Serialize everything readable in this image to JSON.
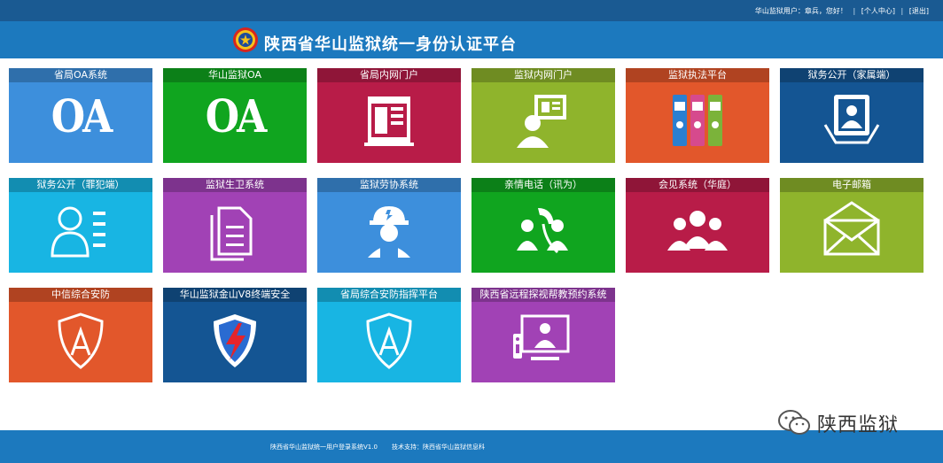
{
  "header": {
    "user_label": "华山监狱用户：章兵，您好！",
    "sep1": "|",
    "personal_center": "[个人中心]",
    "sep2": "|",
    "logout": "[退出]",
    "title": "陕西省华山监狱统一身份认证平台"
  },
  "tiles": [
    {
      "label": "省局OA系统",
      "color": "#3d8fdc",
      "icon": "oa-text-icon",
      "text": "OA"
    },
    {
      "label": "华山监狱OA",
      "color": "#10a51f",
      "icon": "oa-text-icon",
      "text": "OA"
    },
    {
      "label": "省局内网门户",
      "color": "#b81c48",
      "icon": "portal-window-icon"
    },
    {
      "label": "监狱内网门户",
      "color": "#8fb42c",
      "icon": "person-screen-icon"
    },
    {
      "label": "监狱执法平台",
      "color": "#e2572b",
      "icon": "binders-icon"
    },
    {
      "label": "狱务公开（家属端）",
      "color": "#145593",
      "icon": "person-card-icon"
    },
    {
      "label": "狱务公开（罪犯端）",
      "color": "#18b5e3",
      "icon": "person-list-icon"
    },
    {
      "label": "监狱生卫系统",
      "color": "#a142b5",
      "icon": "documents-icon"
    },
    {
      "label": "监狱劳协系统",
      "color": "#3d8fdc",
      "icon": "worker-helmet-icon"
    },
    {
      "label": "亲情电话（讯为）",
      "color": "#10a51f",
      "icon": "phone-people-icon"
    },
    {
      "label": "会见系统（华庭）",
      "color": "#b81c48",
      "icon": "people-group-icon"
    },
    {
      "label": "电子邮箱",
      "color": "#8fb42c",
      "icon": "envelope-icon"
    },
    {
      "label": "中信综合安防",
      "color": "#e2572b",
      "icon": "shield-a-icon"
    },
    {
      "label": "华山监狱金山V8终端安全",
      "color": "#145593",
      "icon": "shield-lightning-icon"
    },
    {
      "label": "省局综合安防指挥平台",
      "color": "#18b5e3",
      "icon": "shield-a-icon"
    },
    {
      "label": "陕西省远程探视帮教预约系统",
      "color": "#a142b5",
      "icon": "monitor-person-icon"
    }
  ],
  "footer": {
    "copyright": "陕西省华山监狱统一用户登录系统V1.0",
    "tech": "技术支持：陕西省华山监狱信息科"
  },
  "watermark": {
    "icon": "wechat-icon",
    "text": "陕西监狱"
  }
}
